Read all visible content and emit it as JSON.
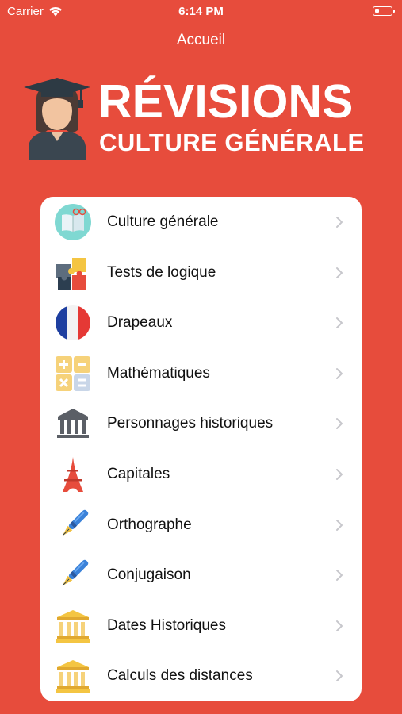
{
  "status_bar": {
    "carrier": "Carrier",
    "time": "6:14 PM",
    "battery_level": 0.3
  },
  "nav": {
    "title": "Accueil"
  },
  "hero": {
    "title": "RÉVISIONS",
    "subtitle": "CULTURE GÉNÉRALE"
  },
  "menu": {
    "items": [
      {
        "label": "Culture générale",
        "icon": "book-icon"
      },
      {
        "label": "Tests de logique",
        "icon": "puzzle-icon"
      },
      {
        "label": "Drapeaux",
        "icon": "french-flag-icon"
      },
      {
        "label": "Mathématiques",
        "icon": "math-operators-icon"
      },
      {
        "label": "Personnages historiques",
        "icon": "museum-icon"
      },
      {
        "label": "Capitales",
        "icon": "eiffel-tower-icon"
      },
      {
        "label": "Orthographe",
        "icon": "fountain-pen-icon"
      },
      {
        "label": "Conjugaison",
        "icon": "fountain-pen-icon"
      },
      {
        "label": "Dates Historiques",
        "icon": "temple-icon"
      },
      {
        "label": "Calculs des distances",
        "icon": "temple-icon"
      }
    ]
  },
  "colors": {
    "background": "#e74c3c",
    "card": "#ffffff",
    "chevron": "#c7c7cc"
  }
}
